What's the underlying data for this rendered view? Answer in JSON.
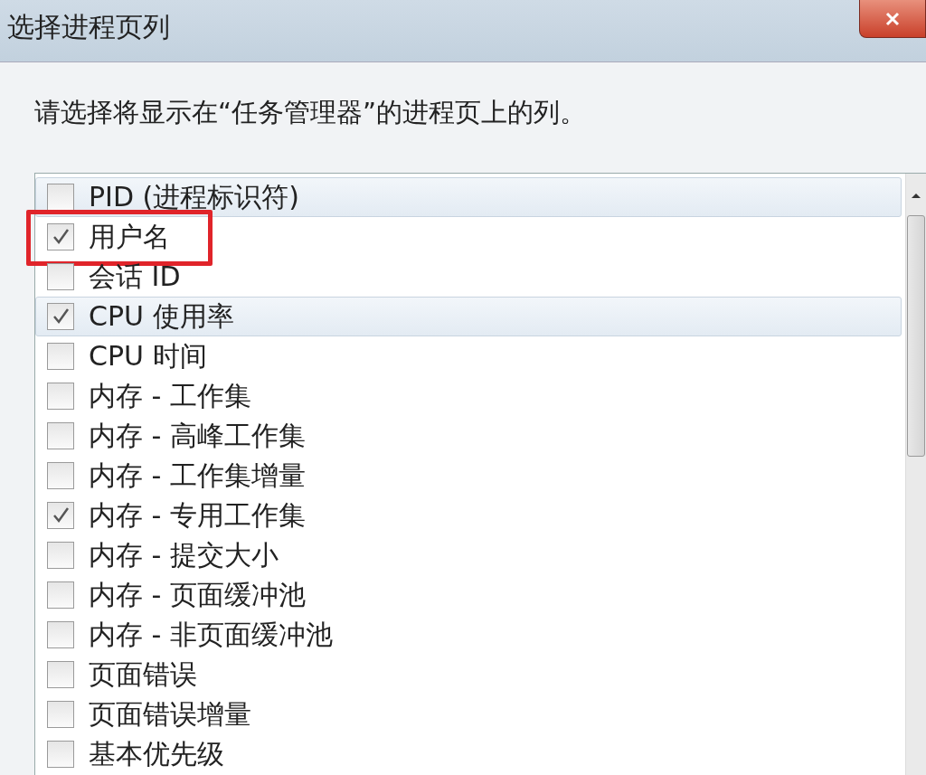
{
  "window": {
    "title": "选择进程页列"
  },
  "instruction": "请选择将显示在“任务管理器”的进程页上的列。",
  "columns": [
    {
      "label": "PID (进程标识符)",
      "checked": false,
      "highlighted": true,
      "marked": false
    },
    {
      "label": "用户名",
      "checked": true,
      "highlighted": false,
      "marked": true
    },
    {
      "label": "会话 ID",
      "checked": false,
      "highlighted": false,
      "marked": false
    },
    {
      "label": "CPU 使用率",
      "checked": true,
      "highlighted": true,
      "marked": false
    },
    {
      "label": "CPU 时间",
      "checked": false,
      "highlighted": false,
      "marked": false
    },
    {
      "label": "内存 - 工作集",
      "checked": false,
      "highlighted": false,
      "marked": false
    },
    {
      "label": "内存 - 高峰工作集",
      "checked": false,
      "highlighted": false,
      "marked": false
    },
    {
      "label": "内存 - 工作集增量",
      "checked": false,
      "highlighted": false,
      "marked": false
    },
    {
      "label": "内存 - 专用工作集",
      "checked": true,
      "highlighted": false,
      "marked": false
    },
    {
      "label": "内存 - 提交大小",
      "checked": false,
      "highlighted": false,
      "marked": false
    },
    {
      "label": "内存 - 页面缓冲池",
      "checked": false,
      "highlighted": false,
      "marked": false
    },
    {
      "label": "内存 - 非页面缓冲池",
      "checked": false,
      "highlighted": false,
      "marked": false
    },
    {
      "label": "页面错误",
      "checked": false,
      "highlighted": false,
      "marked": false
    },
    {
      "label": "页面错误增量",
      "checked": false,
      "highlighted": false,
      "marked": false
    },
    {
      "label": "基本优先级",
      "checked": false,
      "highlighted": false,
      "marked": false
    }
  ]
}
